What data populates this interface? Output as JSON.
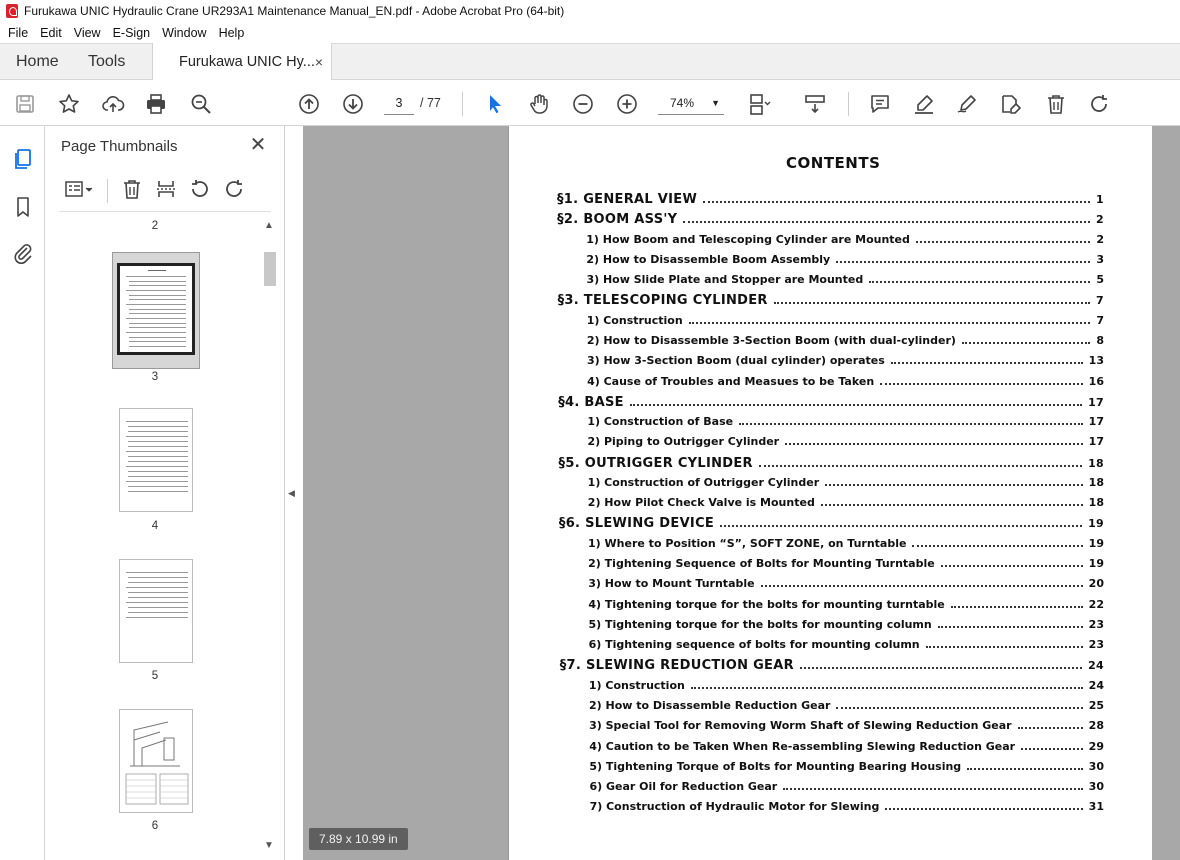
{
  "window": {
    "title": "Furukawa UNIC Hydraulic Crane UR293A1 Maintenance Manual_EN.pdf - Adobe Acrobat Pro (64-bit)"
  },
  "menu": [
    "File",
    "Edit",
    "View",
    "E-Sign",
    "Window",
    "Help"
  ],
  "tabs": {
    "home": "Home",
    "tools": "Tools",
    "document": "Furukawa UNIC Hy...",
    "close_glyph": "×"
  },
  "toolbar": {
    "current_page": "3",
    "total_pages": "/ 77",
    "zoom": "74%"
  },
  "panel": {
    "title": "Page Thumbnails",
    "close_glyph": "✕",
    "thumbs": [
      {
        "label": "2"
      },
      {
        "label": "3"
      },
      {
        "label": "4"
      },
      {
        "label": "5"
      },
      {
        "label": "6"
      }
    ]
  },
  "document": {
    "page_size": "7.89 x 10.99 in",
    "contents_title": "CONTENTS",
    "toc": [
      {
        "type": "sec",
        "label": "§1. GENERAL VIEW",
        "page": "1"
      },
      {
        "type": "sec",
        "label": "§2. BOOM ASS'Y",
        "page": "2"
      },
      {
        "type": "sub",
        "label": "1) How Boom and Telescoping Cylinder are Mounted",
        "page": "2"
      },
      {
        "type": "sub",
        "label": "2) How to Disassemble Boom Assembly",
        "page": "3"
      },
      {
        "type": "sub",
        "label": "3) How Slide Plate and Stopper are Mounted",
        "page": "5"
      },
      {
        "type": "sec",
        "label": "§3. TELESCOPING CYLINDER",
        "page": "7"
      },
      {
        "type": "sub",
        "label": "1) Construction",
        "page": "7"
      },
      {
        "type": "sub",
        "label": "2) How to Disassemble 3-Section Boom (with dual-cylinder)",
        "page": "8"
      },
      {
        "type": "sub",
        "label": "3) How 3-Section Boom (dual cylinder) operates",
        "page": "13"
      },
      {
        "type": "sub",
        "label": "4) Cause of Troubles and Measues to be Taken",
        "page": "16"
      },
      {
        "type": "sec",
        "label": "§4. BASE",
        "page": "17"
      },
      {
        "type": "sub",
        "label": "1) Construction of Base",
        "page": "17"
      },
      {
        "type": "sub",
        "label": "2) Piping to Outrigger Cylinder",
        "page": "17"
      },
      {
        "type": "sec",
        "label": "§5. OUTRIGGER CYLINDER",
        "page": "18"
      },
      {
        "type": "sub",
        "label": "1) Construction of Outrigger Cylinder",
        "page": "18"
      },
      {
        "type": "sub",
        "label": "2) How Pilot Check Valve is Mounted",
        "page": "18"
      },
      {
        "type": "sec",
        "label": "§6. SLEWING DEVICE",
        "page": "19"
      },
      {
        "type": "sub",
        "label": "1) Where to Position “S”, SOFT ZONE, on Turntable",
        "page": "19"
      },
      {
        "type": "sub",
        "label": "2) Tightening Sequence of Bolts for Mounting Turntable",
        "page": "19"
      },
      {
        "type": "sub",
        "label": "3) How to Mount Turntable",
        "page": "20"
      },
      {
        "type": "sub",
        "label": "4) Tightening torque for the bolts for mounting turntable",
        "page": "22"
      },
      {
        "type": "sub",
        "label": "5) Tightening torque for the bolts for mounting column",
        "page": "23"
      },
      {
        "type": "sub",
        "label": "6) Tightening sequence of bolts for mounting column",
        "page": "23"
      },
      {
        "type": "sec",
        "label": "§7. SLEWING REDUCTION GEAR",
        "page": "24"
      },
      {
        "type": "sub",
        "label": "1) Construction",
        "page": "24"
      },
      {
        "type": "sub",
        "label": "2) How to Disassemble Reduction Gear",
        "page": "25"
      },
      {
        "type": "sub",
        "label": "3) Special Tool for Removing Worm Shaft of Slewing Reduction Gear",
        "page": "28"
      },
      {
        "type": "sub",
        "label": "4) Caution to be Taken When Re-assembling Slewing Reduction Gear",
        "page": "29"
      },
      {
        "type": "sub",
        "label": "5) Tightening Torque of Bolts for Mounting Bearing Housing",
        "page": "30"
      },
      {
        "type": "sub",
        "label": "6) Gear Oil for Reduction Gear",
        "page": "30"
      },
      {
        "type": "sub",
        "label": "7) Construction of Hydraulic Motor for Slewing",
        "page": "31"
      }
    ]
  },
  "colors": {
    "accent": "#1473e6",
    "acrobat_red": "#d8232a",
    "doc_background": "#a8a8a8"
  }
}
